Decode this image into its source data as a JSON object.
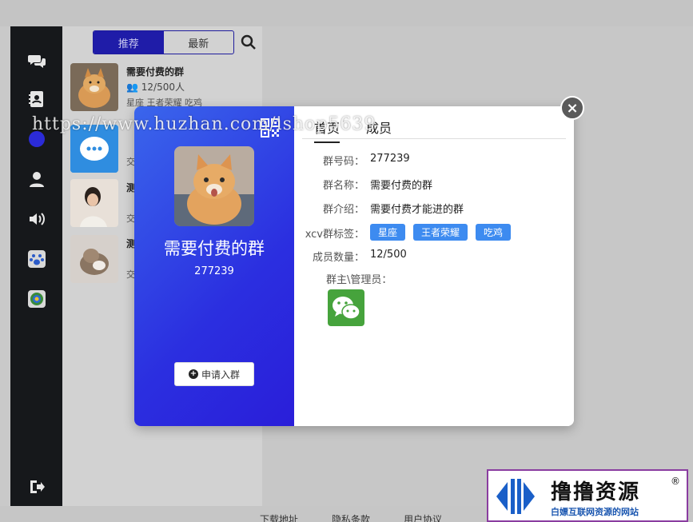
{
  "header": {
    "tabs": [
      {
        "label": "推荐",
        "active": true
      },
      {
        "label": "最新",
        "active": false
      }
    ]
  },
  "sidebar": {
    "icons": [
      "chat-icon",
      "contacts-icon",
      "group-icon",
      "user-icon",
      "speaker-icon",
      "paw-icon",
      "app-icon",
      "logout-icon"
    ]
  },
  "group_list": [
    {
      "name": "需要付费的群",
      "count": "12/500人",
      "tags": "星座 王者荣耀 吃鸡"
    },
    {
      "name": "",
      "count": "",
      "tags": "交"
    },
    {
      "name": "测",
      "count": "",
      "tags": "交"
    },
    {
      "name": "测",
      "count": "",
      "tags": "交"
    }
  ],
  "modal": {
    "group_name": "需要付费的群",
    "group_number": "277239",
    "join_label": "申请入群",
    "tabs": [
      {
        "label": "首页",
        "active": true
      },
      {
        "label": "成员",
        "active": false
      }
    ],
    "fields": {
      "number_label": "群号码：",
      "number_value": "277239",
      "name_label": "群名称：",
      "name_value": "需要付费的群",
      "intro_label": "群介绍：",
      "intro_value": "需要付费才能进的群",
      "tags_label": "xcv群标签：",
      "tags": [
        "星座",
        "王者荣耀",
        "吃鸡"
      ],
      "members_label": "成员数量：",
      "members_value": "12/500",
      "admins_label": "群主\\管理员："
    },
    "close_symbol": "×"
  },
  "footer": {
    "links": [
      "下载地址",
      "隐私条款",
      "用户协议"
    ]
  },
  "watermark": {
    "url": "https://www.huzhan.com/ishop5639"
  },
  "logo": {
    "title": "撸撸资源",
    "subtitle": "白嫖互联网资源的网站",
    "reg": "®"
  },
  "colors": {
    "modal_gradient_start": "#3a66ec",
    "modal_gradient_end": "#2a1ed9",
    "tag_blue": "#3d8bf0",
    "active_tab": "#1f1ca8",
    "sidebar": "#16181b",
    "wechat_green": "#46a33c"
  }
}
